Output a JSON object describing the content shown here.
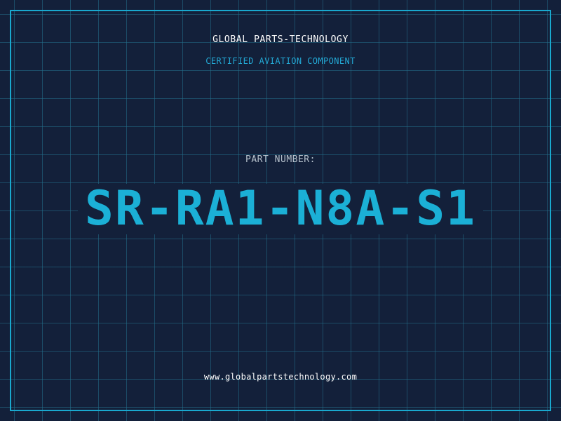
{
  "header": {
    "company_name": "GLOBAL PARTS-TECHNOLOGY",
    "tagline": "CERTIFIED AVIATION COMPONENT"
  },
  "part": {
    "label": "PART NUMBER:",
    "number": "SR-RA1-N8A-S1"
  },
  "footer": {
    "website": "www.globalpartstechnology.com"
  },
  "colors": {
    "background": "#13203a",
    "grid_lines": "#22708c",
    "frame_border": "#19a9cf",
    "accent": "#1bb0d6",
    "heading_text": "#ffffff",
    "label_text": "#b6c1cc"
  }
}
